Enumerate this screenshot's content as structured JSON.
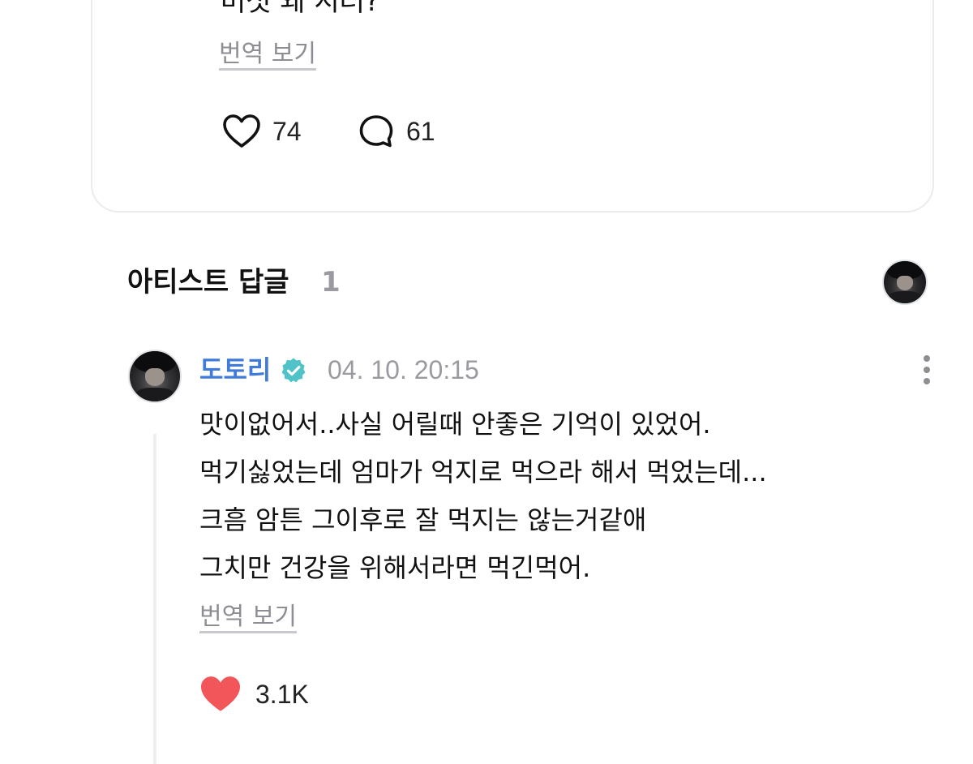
{
  "post": {
    "text": "버섯 왜 시러?",
    "translate_label": "번역 보기",
    "like_count": "74",
    "comment_count": "61",
    "icons": {
      "like": "heart-outline-icon",
      "comment": "speech-bubble-icon"
    }
  },
  "artist_replies": {
    "title": "아티스트 답글",
    "count": "1"
  },
  "reply": {
    "author": "도토리",
    "verified": true,
    "timestamp": "04. 10. 20:15",
    "lines": [
      "맛이없어서..사실 어릴때 안좋은 기억이 있었어.",
      "먹기싫었는데 엄마가 억지로 먹으라 해서 먹었는데...",
      "크흠 암튼 그이후로 잘 먹지는 않는거같애",
      "그치만 건강을 위해서라면 먹긴먹어."
    ],
    "translate_label": "번역 보기",
    "like_count": "3.1K",
    "icons": {
      "like": "heart-filled-icon",
      "verified": "verified-badge-icon",
      "more": "more-vertical-icon"
    }
  },
  "colors": {
    "author_name": "#3f7bd9",
    "verified_badge": "#4fc3c7",
    "liked_heart": "#f2555a",
    "muted_text": "#8d8d93"
  }
}
